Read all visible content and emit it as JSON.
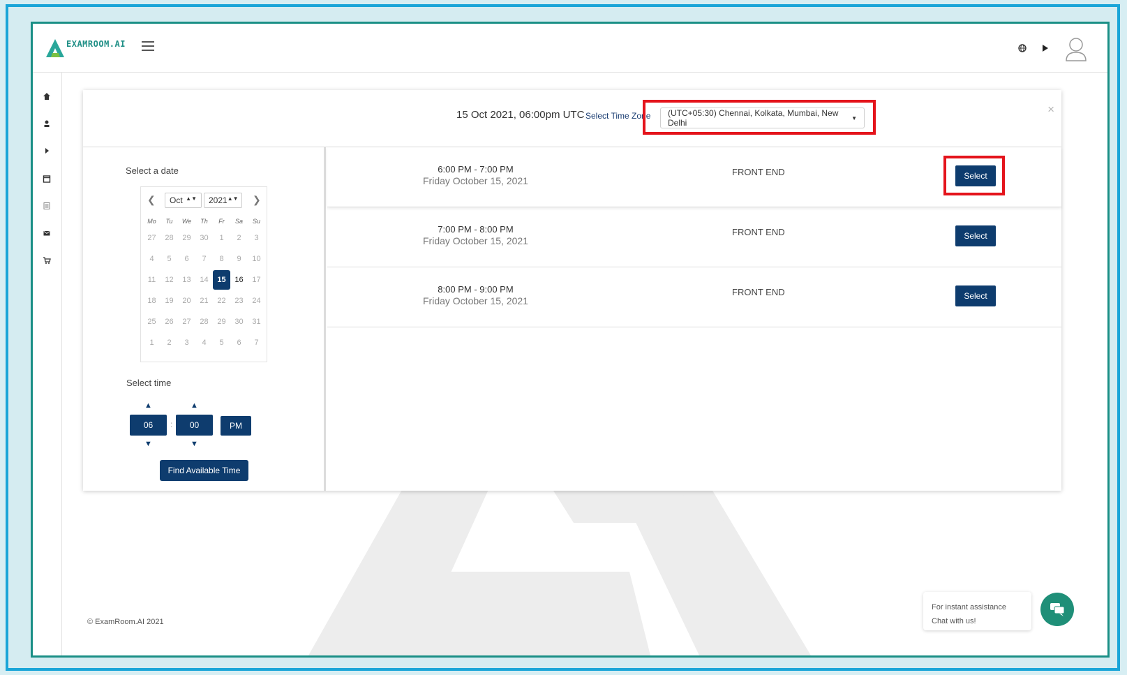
{
  "app": {
    "logo_text": "EXAMROOM.AI"
  },
  "header": {
    "icons": [
      "globe-icon",
      "play-icon",
      "user-avatar-icon"
    ]
  },
  "sidebar": {
    "icons": [
      "home-icon",
      "user-icon",
      "caret-right-icon",
      "calendar-icon",
      "schedule-icon",
      "mail-icon",
      "cart-icon"
    ]
  },
  "panel": {
    "date_utc": "15 Oct 2021, 06:00pm UTC",
    "timezone_label": "Select Time Zone",
    "timezone_value": "(UTC+05:30) Chennai, Kolkata, Mumbai, New Delhi",
    "close": "×"
  },
  "date_picker": {
    "label": "Select a date",
    "month": "Oct",
    "year": "2021",
    "weekdays": [
      "Mo",
      "Tu",
      "We",
      "Th",
      "Fr",
      "Sa",
      "Su"
    ],
    "weeks": [
      [
        "27",
        "28",
        "29",
        "30",
        "1",
        "2",
        "3"
      ],
      [
        "4",
        "5",
        "6",
        "7",
        "8",
        "9",
        "10"
      ],
      [
        "11",
        "12",
        "13",
        "14",
        "15",
        "16",
        "17"
      ],
      [
        "18",
        "19",
        "20",
        "21",
        "22",
        "23",
        "24"
      ],
      [
        "25",
        "26",
        "27",
        "28",
        "29",
        "30",
        "31"
      ],
      [
        "1",
        "2",
        "3",
        "4",
        "5",
        "6",
        "7"
      ]
    ],
    "selected": "15",
    "emphasized": [
      "16"
    ]
  },
  "time_picker": {
    "label": "Select time",
    "hour": "06",
    "minute": "00",
    "separator": ":",
    "meridiem": "PM",
    "find_button": "Find Available Time"
  },
  "slots": [
    {
      "time": "6:00 PM - 7:00 PM",
      "date": "Friday October 15, 2021",
      "title": "FRONT END",
      "button": "Select"
    },
    {
      "time": "7:00 PM - 8:00 PM",
      "date": "Friday October 15, 2021",
      "title": "FRONT END",
      "button": "Select"
    },
    {
      "time": "8:00 PM - 9:00 PM",
      "date": "Friday October 15, 2021",
      "title": "FRONT END",
      "button": "Select"
    }
  ],
  "footer": {
    "copyright": "© ExamRoom.AI 2021",
    "chat_line1": "For instant assistance",
    "chat_line2": "Chat with us!"
  },
  "colors": {
    "primary": "#0e3c6e",
    "brand": "#1f8f86",
    "highlight": "#e4141c",
    "frame": "#1aa5d8"
  }
}
